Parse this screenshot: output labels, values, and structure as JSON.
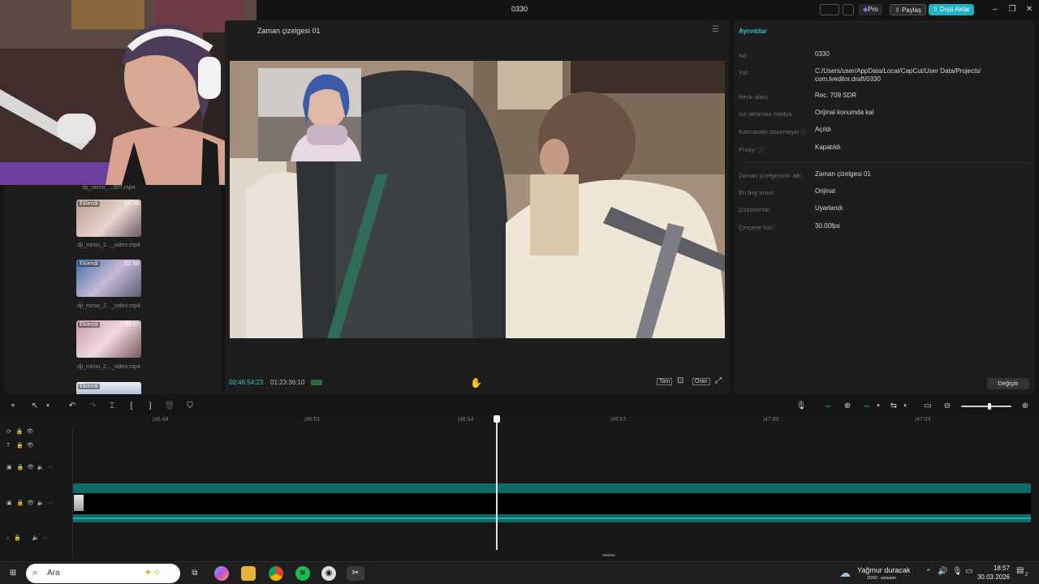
{
  "window": {
    "title": "0330",
    "pro_label": "Pro",
    "share_label": "Paylaş",
    "export_label": "Dışa Aktar"
  },
  "media": {
    "clips": [
      {
        "badge": "",
        "duration": "",
        "name": "dji_mimo_...007.mp4"
      },
      {
        "badge": "Eklendi",
        "duration": "01:36",
        "name": "dji_mimo_2..._video.mp4"
      },
      {
        "badge": "Eklendi",
        "duration": "01:58",
        "name": "dji_mimo_2..._video.mp4"
      },
      {
        "badge": "Eklendi",
        "duration": "00:57",
        "name": "dji_mimo_2..._video.mp4"
      },
      {
        "badge": "Eklendi",
        "duration": "",
        "name": ""
      }
    ]
  },
  "player": {
    "title": "Zaman çizelgesi 01",
    "current_time": "00:46:54:23",
    "total_time": "01:23:36:10",
    "full_label": "Tam",
    "ratio_label": "Oran"
  },
  "details": {
    "header": "Ayrıntılar",
    "rows": [
      {
        "label": "Ad:",
        "value": "0330"
      },
      {
        "label": "Yol:",
        "value": "C:/Users/user/AppData/Local/CapCut/User Data/Projects/ com.lveditor.draft/0330"
      },
      {
        "label": "Renk alanı:",
        "value": "Rec. 709 SDR"
      },
      {
        "label": "İçe aktarılan medya:",
        "value": "Orijinal konumda kal"
      },
      {
        "label": "Katmanları düzenleyin",
        "value": "Açıldı"
      },
      {
        "label": "Proxy:",
        "value": "Kapatıldı"
      },
      {
        "label": "Zaman çizelgesinin adı:",
        "value": "Zaman çizelgesi 01"
      },
      {
        "label": "En boy oranı:",
        "value": "Orijinal"
      },
      {
        "label": "Çözünürlük:",
        "value": "Uyarlandı"
      },
      {
        "label": "Çerçeve hızı:",
        "value": "30.00fps"
      }
    ],
    "change_label": "Değiştir"
  },
  "timeline": {
    "ruler": [
      "|46:48",
      "|46:51",
      "|46:54",
      "|46:57",
      "|47:00",
      "|47:03"
    ]
  },
  "taskbar": {
    "search_placeholder": "Ara",
    "weather_title": "Yağmur duracak",
    "weather_sub": "2DN2 : selaaam",
    "time": "18:57",
    "date": "30.03.2026",
    "notif_count": "2"
  },
  "colors": {
    "accent": "#20c5c9",
    "track": "#0f6b68",
    "export": "#1fb2c4"
  }
}
